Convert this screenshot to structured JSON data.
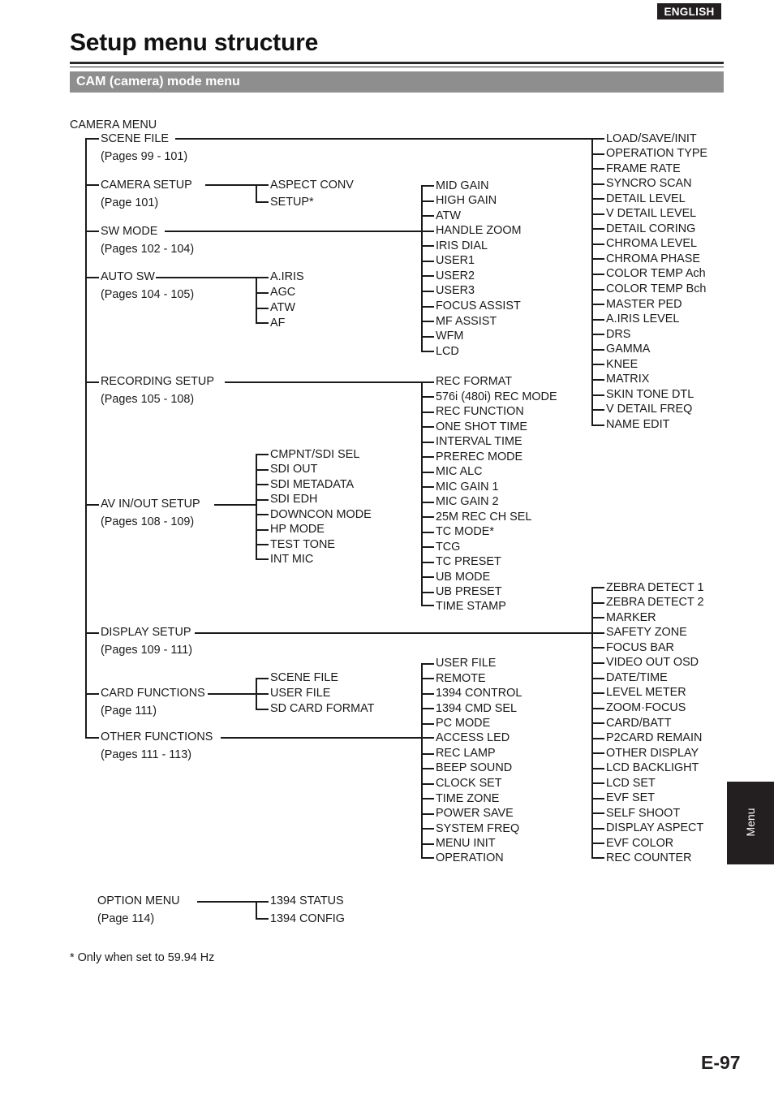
{
  "header": {
    "language_badge": "ENGLISH",
    "title": "Setup menu structure",
    "section_bar": "CAM (camera) mode menu"
  },
  "side_tab": {
    "label": "Menu"
  },
  "footer": {
    "page_label": "E-97"
  },
  "footnote": "* Only when set to 59.94 Hz",
  "tree": {
    "root_label": "CAMERA MENU",
    "level1": [
      {
        "label": "SCENE FILE",
        "pages": "(Pages 99 - 101)"
      },
      {
        "label": "CAMERA SETUP",
        "pages": "(Page 101)"
      },
      {
        "label": "SW MODE",
        "pages": "(Pages 102 - 104)"
      },
      {
        "label": "AUTO SW",
        "pages": "(Pages 104 - 105)"
      },
      {
        "label": "RECORDING SETUP",
        "pages": "(Pages 105 - 108)"
      },
      {
        "label": "AV IN/OUT SETUP",
        "pages": "(Pages 108 - 109)"
      },
      {
        "label": "DISPLAY SETUP",
        "pages": "(Pages 109 - 111)"
      },
      {
        "label": "CARD FUNCTIONS",
        "pages": "(Page 111)"
      },
      {
        "label": "OTHER FUNCTIONS",
        "pages": "(Pages 111 - 113)"
      }
    ],
    "camera_setup_children": [
      "ASPECT CONV",
      "SETUP*"
    ],
    "auto_sw_children": [
      "A.IRIS",
      "AGC",
      "ATW",
      "AF"
    ],
    "av_inout_children": [
      "CMPNT/SDI SEL",
      "SDI OUT",
      "SDI METADATA",
      "SDI EDH",
      "DOWNCON MODE",
      "HP MODE",
      "TEST TONE",
      "INT MIC"
    ],
    "card_functions_children": [
      "SCENE FILE",
      "USER FILE",
      "SD CARD FORMAT"
    ],
    "sw_mode_children": [
      "MID GAIN",
      "HIGH GAIN",
      "ATW",
      "HANDLE ZOOM",
      "IRIS DIAL",
      "USER1",
      "USER2",
      "USER3",
      "FOCUS ASSIST",
      "MF ASSIST",
      "WFM",
      "LCD"
    ],
    "recording_setup_children": [
      "REC FORMAT",
      "576i (480i) REC MODE",
      "REC FUNCTION",
      "ONE SHOT TIME",
      "INTERVAL TIME",
      "PREREC MODE",
      "MIC ALC",
      "MIC GAIN 1",
      "MIC GAIN 2",
      "25M REC CH SEL",
      "TC MODE*",
      "TCG",
      "TC PRESET",
      "UB MODE",
      "UB PRESET",
      "TIME STAMP"
    ],
    "other_functions_children": [
      "USER FILE",
      "REMOTE",
      "1394 CONTROL",
      "1394 CMD SEL",
      "PC MODE",
      "ACCESS LED",
      "REC LAMP",
      "BEEP SOUND",
      "CLOCK SET",
      "TIME ZONE",
      "POWER SAVE",
      "SYSTEM FREQ",
      "MENU INIT",
      "OPERATION"
    ],
    "scene_file_children": [
      "LOAD/SAVE/INIT",
      "OPERATION TYPE",
      "FRAME RATE",
      "SYNCRO SCAN",
      "DETAIL LEVEL",
      "V DETAIL LEVEL",
      "DETAIL CORING",
      "CHROMA LEVEL",
      "CHROMA PHASE",
      "COLOR TEMP Ach",
      "COLOR TEMP Bch",
      "MASTER PED",
      "A.IRIS LEVEL",
      "DRS",
      "GAMMA",
      "KNEE",
      "MATRIX",
      "SKIN TONE DTL",
      "V DETAIL FREQ",
      "NAME EDIT"
    ],
    "display_setup_children": [
      "ZEBRA DETECT 1",
      "ZEBRA DETECT 2",
      "MARKER",
      "SAFETY ZONE",
      "FOCUS BAR",
      "VIDEO OUT OSD",
      "DATE/TIME",
      "LEVEL METER",
      "ZOOM·FOCUS",
      "CARD/BATT",
      "P2CARD REMAIN",
      "OTHER DISPLAY",
      "LCD BACKLIGHT",
      "LCD SET",
      "EVF SET",
      "SELF SHOOT",
      "DISPLAY ASPECT",
      "EVF COLOR",
      "REC COUNTER"
    ],
    "option_menu": {
      "label": "OPTION MENU",
      "pages": "(Page 114)"
    },
    "option_menu_children": [
      "1394 STATUS",
      "1394 CONFIG"
    ]
  }
}
